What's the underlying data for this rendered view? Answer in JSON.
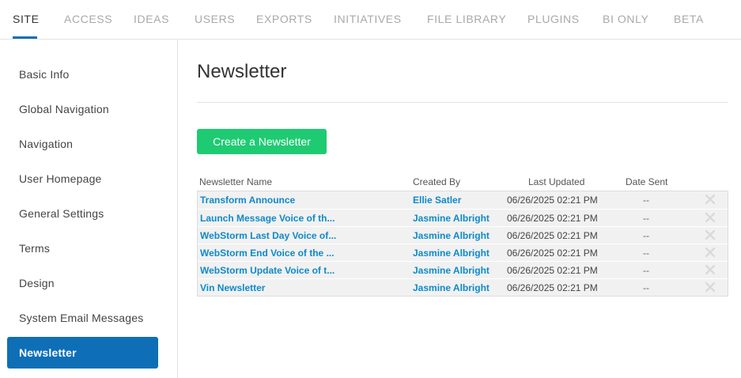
{
  "topnav": {
    "tabs": [
      {
        "label": "SITE",
        "active": true
      },
      {
        "label": "ACCESS"
      },
      {
        "label": "IDEAS"
      },
      {
        "label": "USERS"
      },
      {
        "label": "EXPORTS"
      },
      {
        "label": "INITIATIVES"
      },
      {
        "label": "FILE LIBRARY"
      },
      {
        "label": "PLUGINS"
      },
      {
        "label": "BI ONLY"
      },
      {
        "label": "BETA"
      }
    ]
  },
  "sidebar": {
    "items": [
      {
        "label": "Basic Info"
      },
      {
        "label": "Global Navigation"
      },
      {
        "label": "Navigation"
      },
      {
        "label": "User Homepage"
      },
      {
        "label": "General Settings"
      },
      {
        "label": "Terms"
      },
      {
        "label": "Design"
      },
      {
        "label": "System Email Messages"
      },
      {
        "label": "Newsletter",
        "active": true
      }
    ]
  },
  "main": {
    "title": "Newsletter",
    "create_button": "Create a Newsletter",
    "table": {
      "headers": {
        "name": "Newsletter Name",
        "created_by": "Created By",
        "last_updated": "Last Updated",
        "date_sent": "Date Sent"
      },
      "rows": [
        {
          "name": "Transform Announce",
          "created_by": "Ellie Satler",
          "last_updated": "06/26/2025 02:21 PM",
          "date_sent": "--"
        },
        {
          "name": "Launch Message Voice of th...",
          "created_by": "Jasmine Albright",
          "last_updated": "06/26/2025 02:21 PM",
          "date_sent": "--"
        },
        {
          "name": "WebStorm Last Day Voice of...",
          "created_by": "Jasmine Albright",
          "last_updated": "06/26/2025 02:21 PM",
          "date_sent": "--"
        },
        {
          "name": "WebStorm End Voice of the ...",
          "created_by": "Jasmine Albright",
          "last_updated": "06/26/2025 02:21 PM",
          "date_sent": "--"
        },
        {
          "name": "WebStorm Update Voice of t...",
          "created_by": "Jasmine Albright",
          "last_updated": "06/26/2025 02:21 PM",
          "date_sent": "--"
        },
        {
          "name": "Vin Newsletter",
          "created_by": "Jasmine Albright",
          "last_updated": "06/26/2025 02:21 PM",
          "date_sent": "--"
        }
      ]
    }
  },
  "colors": {
    "accent_blue": "#0e6fb6",
    "link_blue": "#0e8ac9",
    "button_green": "#1ecb72"
  },
  "icons": {
    "delete": "close-icon"
  }
}
